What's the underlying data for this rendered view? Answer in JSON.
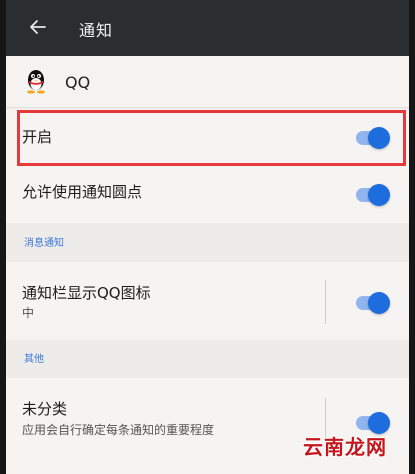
{
  "header": {
    "title": "通知",
    "back_icon": "back-arrow-icon"
  },
  "app": {
    "name": "QQ",
    "icon": "qq-penguin-icon"
  },
  "settings": {
    "enable": {
      "title": "开启",
      "toggle_on": true
    },
    "dots": {
      "title": "允许使用通知圆点",
      "toggle_on": true
    },
    "section_message": "消息通知",
    "statusbar": {
      "title": "通知栏显示QQ图标",
      "subtitle": "中",
      "toggle_on": true
    },
    "section_other": "其他",
    "uncategorized": {
      "title": "未分类",
      "subtitle": "应用会自行确定每条通知的重要程度",
      "toggle_on": true
    }
  },
  "watermark": "云南龙网",
  "colors": {
    "header_bg": "#2b2d30",
    "toggle_track": "#8fb4ee",
    "toggle_knob": "#1e6ddf",
    "section_label": "#3a77d6",
    "highlight": "#e63a3a",
    "watermark": "#c4161c"
  }
}
